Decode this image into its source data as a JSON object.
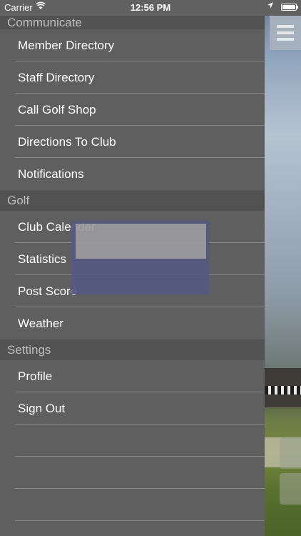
{
  "status_bar": {
    "carrier": "Carrier",
    "time": "12:56 PM",
    "icons": [
      "wifi-icon",
      "location-icon",
      "battery-icon"
    ]
  },
  "sections": [
    {
      "header": "Communicate",
      "items": [
        "Member Directory",
        "Staff Directory",
        "Call Golf Shop",
        "Directions To Club",
        "Notifications"
      ]
    },
    {
      "header": "Golf",
      "items": [
        "Club Calendar",
        "Statistics",
        "Post Score",
        "Weather"
      ]
    },
    {
      "header": "Settings",
      "items": [
        "Profile",
        "Sign Out"
      ]
    }
  ],
  "menu_button_icon": "hamburger-menu-icon",
  "colors": {
    "menu_background": "#5f5f5f",
    "section_header_background": "#525252",
    "section_header_text": "#bfbfbf",
    "item_text": "#ffffff",
    "separator": "#878787"
  }
}
